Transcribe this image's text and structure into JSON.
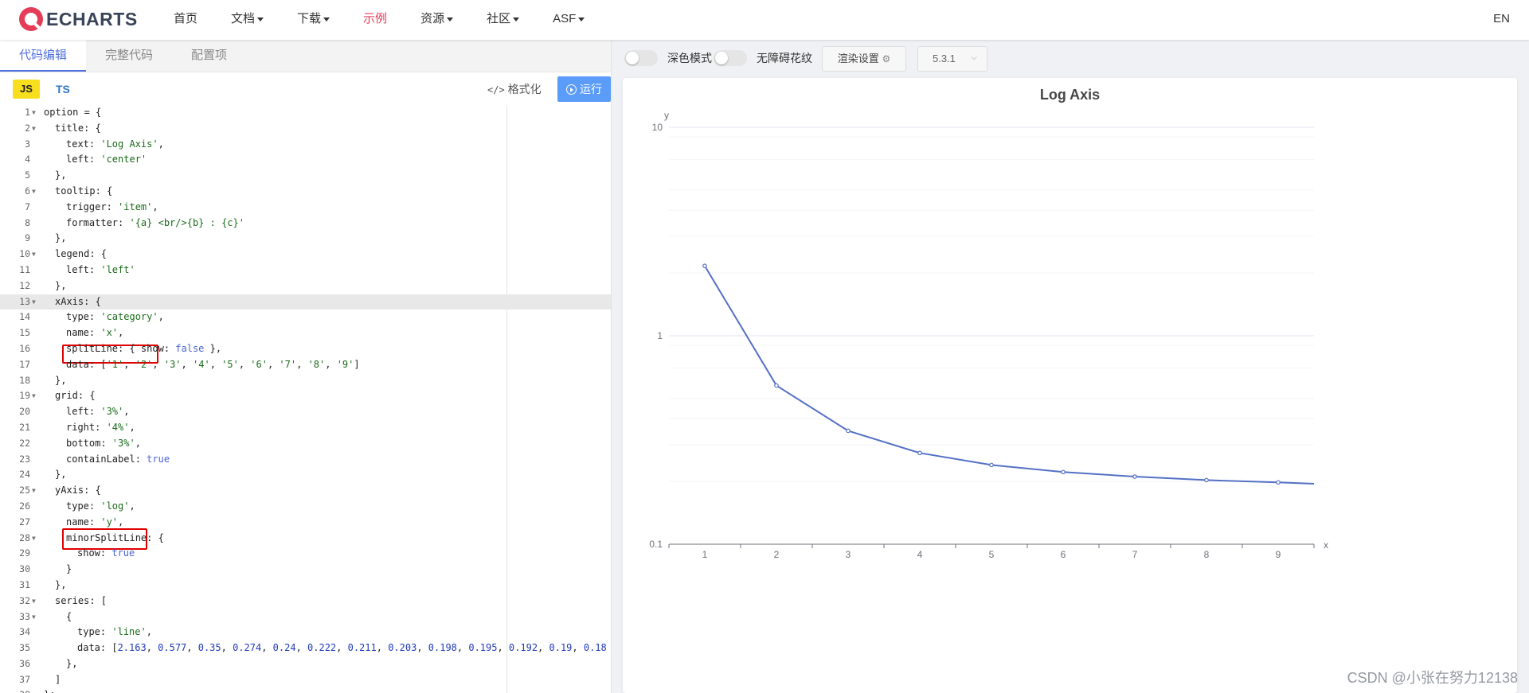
{
  "nav": {
    "logo_text": "ECHARTS",
    "items": [
      {
        "label": "首页",
        "has_caret": false,
        "active": false
      },
      {
        "label": "文档",
        "has_caret": true,
        "active": false
      },
      {
        "label": "下载",
        "has_caret": true,
        "active": false
      },
      {
        "label": "示例",
        "has_caret": false,
        "active": true
      },
      {
        "label": "资源",
        "has_caret": true,
        "active": false
      },
      {
        "label": "社区",
        "has_caret": true,
        "active": false
      },
      {
        "label": "ASF",
        "has_caret": true,
        "active": false
      }
    ],
    "lang": "EN"
  },
  "editor": {
    "tabs": [
      "代码编辑",
      "完整代码",
      "配置项"
    ],
    "lang_js": "JS",
    "lang_ts": "TS",
    "format_label": "格式化",
    "run_label": "运行",
    "lines": [
      {
        "n": "1",
        "fold": true,
        "indent": 0,
        "tokens": [
          [
            "p",
            "option = {"
          ]
        ]
      },
      {
        "n": "2",
        "fold": true,
        "indent": 1,
        "tokens": [
          [
            "p",
            "title: {"
          ]
        ]
      },
      {
        "n": "3",
        "fold": false,
        "indent": 2,
        "tokens": [
          [
            "p",
            "text: "
          ],
          [
            "s",
            "'Log Axis'"
          ],
          [
            "p",
            ","
          ]
        ]
      },
      {
        "n": "4",
        "fold": false,
        "indent": 2,
        "tokens": [
          [
            "p",
            "left: "
          ],
          [
            "s",
            "'center'"
          ]
        ]
      },
      {
        "n": "5",
        "fold": false,
        "indent": 1,
        "tokens": [
          [
            "p",
            "},"
          ]
        ]
      },
      {
        "n": "6",
        "fold": true,
        "indent": 1,
        "tokens": [
          [
            "p",
            "tooltip: {"
          ]
        ]
      },
      {
        "n": "7",
        "fold": false,
        "indent": 2,
        "tokens": [
          [
            "p",
            "trigger: "
          ],
          [
            "s",
            "'item'"
          ],
          [
            "p",
            ","
          ]
        ]
      },
      {
        "n": "8",
        "fold": false,
        "indent": 2,
        "tokens": [
          [
            "p",
            "formatter: "
          ],
          [
            "s",
            "'{a} <br/>{b} : {c}'"
          ]
        ]
      },
      {
        "n": "9",
        "fold": false,
        "indent": 1,
        "tokens": [
          [
            "p",
            "},"
          ]
        ]
      },
      {
        "n": "10",
        "fold": true,
        "indent": 1,
        "tokens": [
          [
            "p",
            "legend: {"
          ]
        ]
      },
      {
        "n": "11",
        "fold": false,
        "indent": 2,
        "tokens": [
          [
            "p",
            "left: "
          ],
          [
            "s",
            "'left'"
          ]
        ]
      },
      {
        "n": "12",
        "fold": false,
        "indent": 1,
        "tokens": [
          [
            "p",
            "},"
          ]
        ]
      },
      {
        "n": "13",
        "fold": true,
        "indent": 1,
        "highlight": true,
        "tokens": [
          [
            "p",
            "xAxis: {"
          ]
        ]
      },
      {
        "n": "14",
        "fold": false,
        "indent": 2,
        "tokens": [
          [
            "p",
            "type: "
          ],
          [
            "s",
            "'category'"
          ],
          [
            "p",
            ","
          ]
        ]
      },
      {
        "n": "15",
        "fold": false,
        "indent": 2,
        "tokens": [
          [
            "p",
            "name: "
          ],
          [
            "s",
            "'x'"
          ],
          [
            "p",
            ","
          ]
        ]
      },
      {
        "n": "16",
        "fold": false,
        "indent": 2,
        "tokens": [
          [
            "p",
            "splitLine: { show: "
          ],
          [
            "b",
            "false"
          ],
          [
            "p",
            " },"
          ]
        ]
      },
      {
        "n": "17",
        "fold": false,
        "indent": 2,
        "tokens": [
          [
            "p",
            "data: ["
          ],
          [
            "s",
            "'1'"
          ],
          [
            "p",
            ", "
          ],
          [
            "s",
            "'2'"
          ],
          [
            "p",
            ", "
          ],
          [
            "s",
            "'3'"
          ],
          [
            "p",
            ", "
          ],
          [
            "s",
            "'4'"
          ],
          [
            "p",
            ", "
          ],
          [
            "s",
            "'5'"
          ],
          [
            "p",
            ", "
          ],
          [
            "s",
            "'6'"
          ],
          [
            "p",
            ", "
          ],
          [
            "s",
            "'7'"
          ],
          [
            "p",
            ", "
          ],
          [
            "s",
            "'8'"
          ],
          [
            "p",
            ", "
          ],
          [
            "s",
            "'9'"
          ],
          [
            "p",
            "]"
          ]
        ]
      },
      {
        "n": "18",
        "fold": false,
        "indent": 1,
        "tokens": [
          [
            "p",
            "},"
          ]
        ]
      },
      {
        "n": "19",
        "fold": true,
        "indent": 1,
        "tokens": [
          [
            "p",
            "grid: {"
          ]
        ]
      },
      {
        "n": "20",
        "fold": false,
        "indent": 2,
        "tokens": [
          [
            "p",
            "left: "
          ],
          [
            "s",
            "'3%'"
          ],
          [
            "p",
            ","
          ]
        ]
      },
      {
        "n": "21",
        "fold": false,
        "indent": 2,
        "tokens": [
          [
            "p",
            "right: "
          ],
          [
            "s",
            "'4%'"
          ],
          [
            "p",
            ","
          ]
        ]
      },
      {
        "n": "22",
        "fold": false,
        "indent": 2,
        "tokens": [
          [
            "p",
            "bottom: "
          ],
          [
            "s",
            "'3%'"
          ],
          [
            "p",
            ","
          ]
        ]
      },
      {
        "n": "23",
        "fold": false,
        "indent": 2,
        "tokens": [
          [
            "p",
            "containLabel: "
          ],
          [
            "b",
            "true"
          ]
        ]
      },
      {
        "n": "24",
        "fold": false,
        "indent": 1,
        "tokens": [
          [
            "p",
            "},"
          ]
        ]
      },
      {
        "n": "25",
        "fold": true,
        "indent": 1,
        "tokens": [
          [
            "p",
            "yAxis: {"
          ]
        ]
      },
      {
        "n": "26",
        "fold": false,
        "indent": 2,
        "tokens": [
          [
            "p",
            "type: "
          ],
          [
            "s",
            "'log'"
          ],
          [
            "p",
            ","
          ]
        ]
      },
      {
        "n": "27",
        "fold": false,
        "indent": 2,
        "tokens": [
          [
            "p",
            "name: "
          ],
          [
            "s",
            "'y'"
          ],
          [
            "p",
            ","
          ]
        ]
      },
      {
        "n": "28",
        "fold": true,
        "indent": 2,
        "tokens": [
          [
            "p",
            "minorSplitLine: {"
          ]
        ]
      },
      {
        "n": "29",
        "fold": false,
        "indent": 3,
        "tokens": [
          [
            "p",
            "show: "
          ],
          [
            "b",
            "true"
          ]
        ]
      },
      {
        "n": "30",
        "fold": false,
        "indent": 2,
        "tokens": [
          [
            "p",
            "}"
          ]
        ]
      },
      {
        "n": "31",
        "fold": false,
        "indent": 1,
        "tokens": [
          [
            "p",
            "},"
          ]
        ]
      },
      {
        "n": "32",
        "fold": true,
        "indent": 1,
        "tokens": [
          [
            "p",
            "series: ["
          ]
        ]
      },
      {
        "n": "33",
        "fold": true,
        "indent": 2,
        "tokens": [
          [
            "p",
            "{"
          ]
        ]
      },
      {
        "n": "34",
        "fold": false,
        "indent": 3,
        "tokens": [
          [
            "p",
            "type: "
          ],
          [
            "s",
            "'line'"
          ],
          [
            "p",
            ","
          ]
        ]
      },
      {
        "n": "35",
        "fold": false,
        "indent": 3,
        "tokens": [
          [
            "p",
            "data: ["
          ],
          [
            "d",
            "2.163"
          ],
          [
            "p",
            ", "
          ],
          [
            "d",
            "0.577"
          ],
          [
            "p",
            ", "
          ],
          [
            "d",
            "0.35"
          ],
          [
            "p",
            ", "
          ],
          [
            "d",
            "0.274"
          ],
          [
            "p",
            ", "
          ],
          [
            "d",
            "0.24"
          ],
          [
            "p",
            ", "
          ],
          [
            "d",
            "0.222"
          ],
          [
            "p",
            ", "
          ],
          [
            "d",
            "0.211"
          ],
          [
            "p",
            ", "
          ],
          [
            "d",
            "0.203"
          ],
          [
            "p",
            ", "
          ],
          [
            "d",
            "0.198"
          ],
          [
            "p",
            ", "
          ],
          [
            "d",
            "0.195"
          ],
          [
            "p",
            ", "
          ],
          [
            "d",
            "0.192"
          ],
          [
            "p",
            ", "
          ],
          [
            "d",
            "0.19"
          ],
          [
            "p",
            ", "
          ],
          [
            "d",
            "0.18"
          ]
        ]
      },
      {
        "n": "36",
        "fold": false,
        "indent": 2,
        "tokens": [
          [
            "p",
            "},"
          ]
        ]
      },
      {
        "n": "37",
        "fold": false,
        "indent": 1,
        "tokens": [
          [
            "p",
            "]"
          ]
        ]
      },
      {
        "n": "38",
        "fold": false,
        "indent": 0,
        "tokens": [
          [
            "p",
            "};"
          ]
        ]
      }
    ]
  },
  "preview": {
    "dark_mode_label": "深色模式",
    "decal_label": "无障碍花纹",
    "render_settings_label": "渲染设置",
    "version": "5.3.1"
  },
  "watermark": "CSDN @小张在努力12138",
  "colors": {
    "accent": "#5070dd",
    "brand_red": "#e43c59",
    "series": "#5470c6",
    "highlight_box": "#e00000"
  },
  "chart_data": {
    "type": "line",
    "title": "Log Axis",
    "xlabel": "x",
    "ylabel": "y",
    "categories": [
      "1",
      "2",
      "3",
      "4",
      "5",
      "6",
      "7",
      "8",
      "9"
    ],
    "x_tick_labels": [
      "1",
      "2",
      "3",
      "4",
      "5",
      "6",
      "7",
      "8",
      "9"
    ],
    "y_scale": "log",
    "ylim": [
      0.1,
      10
    ],
    "y_tick_labels": [
      "0.1",
      "1",
      "10"
    ],
    "y_ticks": [
      0.1,
      1,
      10
    ],
    "minor_grid": true,
    "series": [
      {
        "values": [
          2.163,
          0.577,
          0.35,
          0.274,
          0.24,
          0.222,
          0.211,
          0.203,
          0.198,
          0.195
        ]
      }
    ]
  }
}
